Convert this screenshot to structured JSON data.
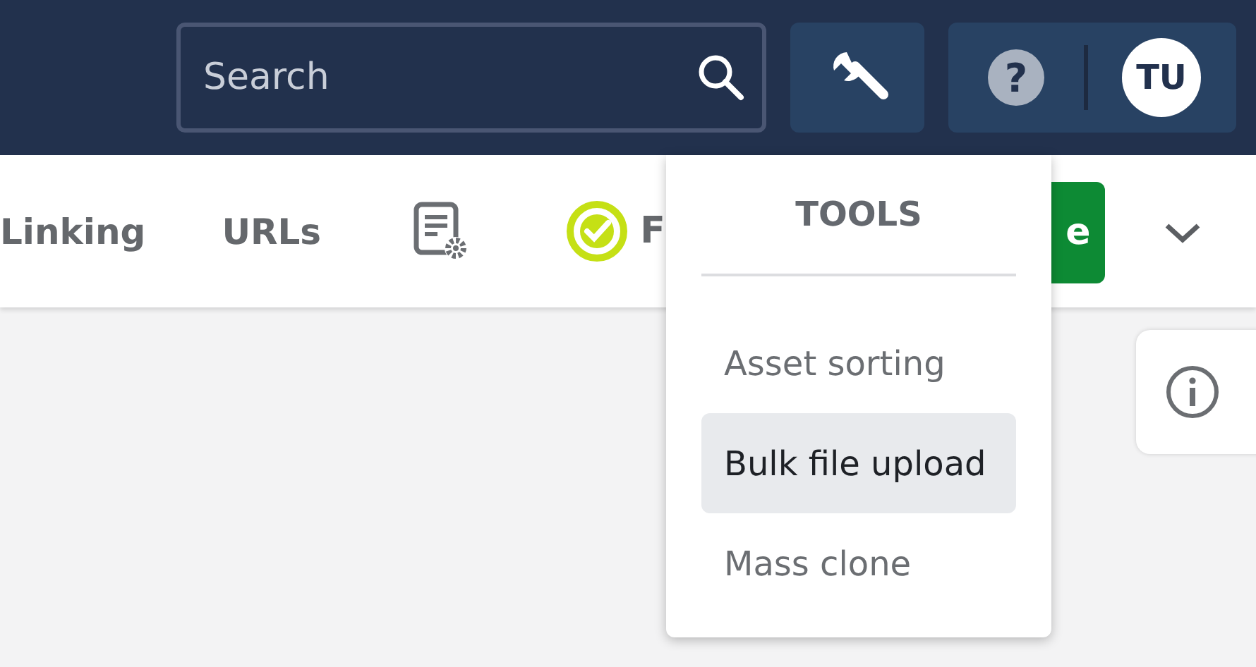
{
  "header": {
    "search": {
      "placeholder": "Search"
    },
    "tools_button": {
      "expanded": true
    },
    "help": {
      "glyph": "?"
    },
    "avatar": {
      "initials": "TU"
    }
  },
  "nav": {
    "items": [
      {
        "kind": "text",
        "label": "Linking"
      },
      {
        "kind": "text",
        "label": "URLs"
      },
      {
        "kind": "settings-doc"
      },
      {
        "kind": "status",
        "label": "F"
      }
    ],
    "action_button": {
      "label": "e"
    }
  },
  "tools_menu": {
    "title": "TOOLS",
    "items": [
      {
        "label": "Asset sorting",
        "selected": false
      },
      {
        "label": "Bulk file upload",
        "selected": true
      },
      {
        "label": "Mass clone",
        "selected": false
      }
    ]
  }
}
